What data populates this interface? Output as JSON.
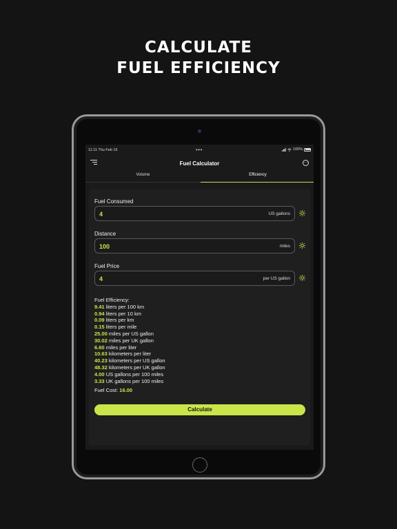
{
  "headline": {
    "line1": "CALCULATE",
    "line2": "FUEL EFFICIENCY"
  },
  "status_bar": {
    "time_date": "11:11  Thu Feb 16",
    "dots": "•••",
    "battery": "100%"
  },
  "nav": {
    "title": "Fuel Calculator",
    "menu_icon": "menu-icon",
    "more_icon": "more-icon"
  },
  "tabs": [
    {
      "label": "Volume",
      "active": false
    },
    {
      "label": "Efficiency",
      "active": true
    }
  ],
  "fields": [
    {
      "label": "Fuel Consumed",
      "value": "4",
      "unit": "US gallons",
      "icon": "gear-icon"
    },
    {
      "label": "Distance",
      "value": "100",
      "unit": "miles",
      "icon": "gear-icon"
    },
    {
      "label": "Fuel Price",
      "value": "4",
      "unit": "per US gallon",
      "icon": "gear-icon"
    }
  ],
  "results": {
    "title": "Fuel Efficiency:",
    "rows": [
      {
        "value": "9.41",
        "label": "liters per 100 km"
      },
      {
        "value": "0.94",
        "label": "liters per 10 km"
      },
      {
        "value": "0.09",
        "label": "liters per km"
      },
      {
        "value": "0.15",
        "label": "liters per mile"
      },
      {
        "value": "25.00",
        "label": "miles per US gallon"
      },
      {
        "value": "30.02",
        "label": "miles per UK gallon"
      },
      {
        "value": "6.60",
        "label": "miles per liter"
      },
      {
        "value": "10.63",
        "label": "kilometers per liter"
      },
      {
        "value": "40.23",
        "label": "kilometers per US gallon"
      },
      {
        "value": "48.32",
        "label": "kilometers per UK gallon"
      },
      {
        "value": "4.00",
        "label": "US gallons per 100 miles"
      },
      {
        "value": "3.33",
        "label": "UK gallons per 100 miles"
      }
    ],
    "cost_label": "Fuel Cost:",
    "cost_value": "16.00"
  },
  "calculate_button": {
    "label": "Calculate"
  },
  "colors": {
    "accent": "#c8e64a",
    "background": "#141414",
    "panel": "#1f1f1f"
  }
}
